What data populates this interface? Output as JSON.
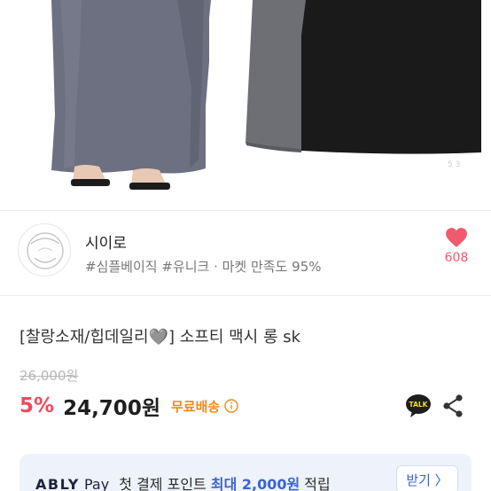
{
  "seller": {
    "name": "시이로",
    "tags": "#심플베이직 #유니크 · 마켓 만족도 95%",
    "like_count": "608"
  },
  "product": {
    "title": "[찰랑소재/힙데일리🩶] 소프티 맥시 롱 sk",
    "original_price": "26,000원",
    "discount": "5%",
    "price": "24,700원",
    "shipping": "무료배송"
  },
  "banner": {
    "brand": "ABLY",
    "pay": "Pay",
    "text_before": "첫 결제 포인트 ",
    "highlight": "최대 2,000원",
    "text_after": " 적립",
    "button_label": "받기 〉"
  },
  "colors": {
    "like_red": "#f05a6e",
    "discount_red": "#f04a5d",
    "shipping_orange": "#ef8a1c",
    "banner_blue": "#3a63d8",
    "banner_bg": "#eef3fb",
    "talk_yellow": "#f9d71c"
  },
  "icons": {
    "like": "heart-icon",
    "info": "info-icon",
    "talk": "kakaotalk-icon",
    "share": "share-icon"
  }
}
